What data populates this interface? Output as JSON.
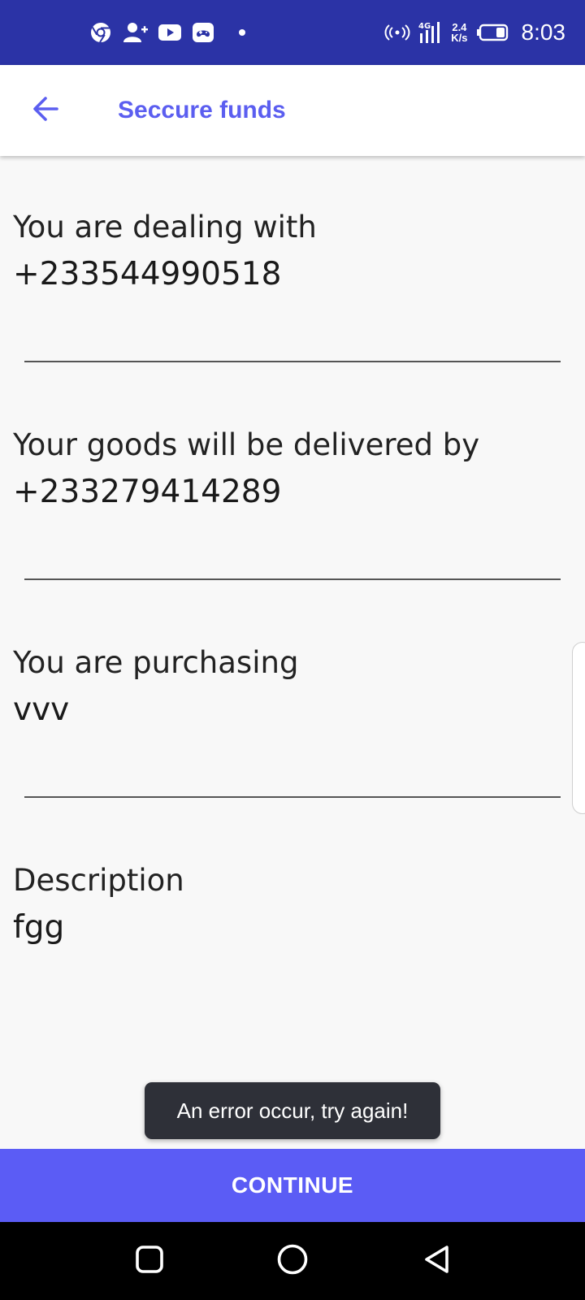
{
  "status_bar": {
    "time": "8:03",
    "network_speed_value": "2.4",
    "network_speed_unit": "K/s",
    "network_type": "4G",
    "left_icons": [
      "chrome-icon",
      "add-contact-icon",
      "youtube-icon",
      "game-icon",
      "notification-dot"
    ],
    "right_icons": [
      "hotspot-icon",
      "signal-icon",
      "battery-icon"
    ]
  },
  "app_bar": {
    "title": "Seccure funds",
    "back_icon": "arrow-left-icon"
  },
  "fields": [
    {
      "label": "You are dealing with",
      "value": "+233544990518"
    },
    {
      "label": "Your goods will be delivered by",
      "value": "+233279414289"
    },
    {
      "label": "You are purchasing",
      "value": "vvv"
    },
    {
      "label": "Description",
      "value": "fgg"
    }
  ],
  "toast": {
    "message": "An error occur, try again!"
  },
  "continue_button": {
    "label": "CONTINUE"
  },
  "nav_bar": {
    "buttons": [
      "recents-square-icon",
      "home-circle-icon",
      "back-triangle-icon"
    ]
  },
  "colors": {
    "status_bar": "#2b33a6",
    "accent": "#5b5ef0",
    "button": "#5b5cf5",
    "toast_bg": "#2e3038",
    "background": "#f8f8f8"
  }
}
